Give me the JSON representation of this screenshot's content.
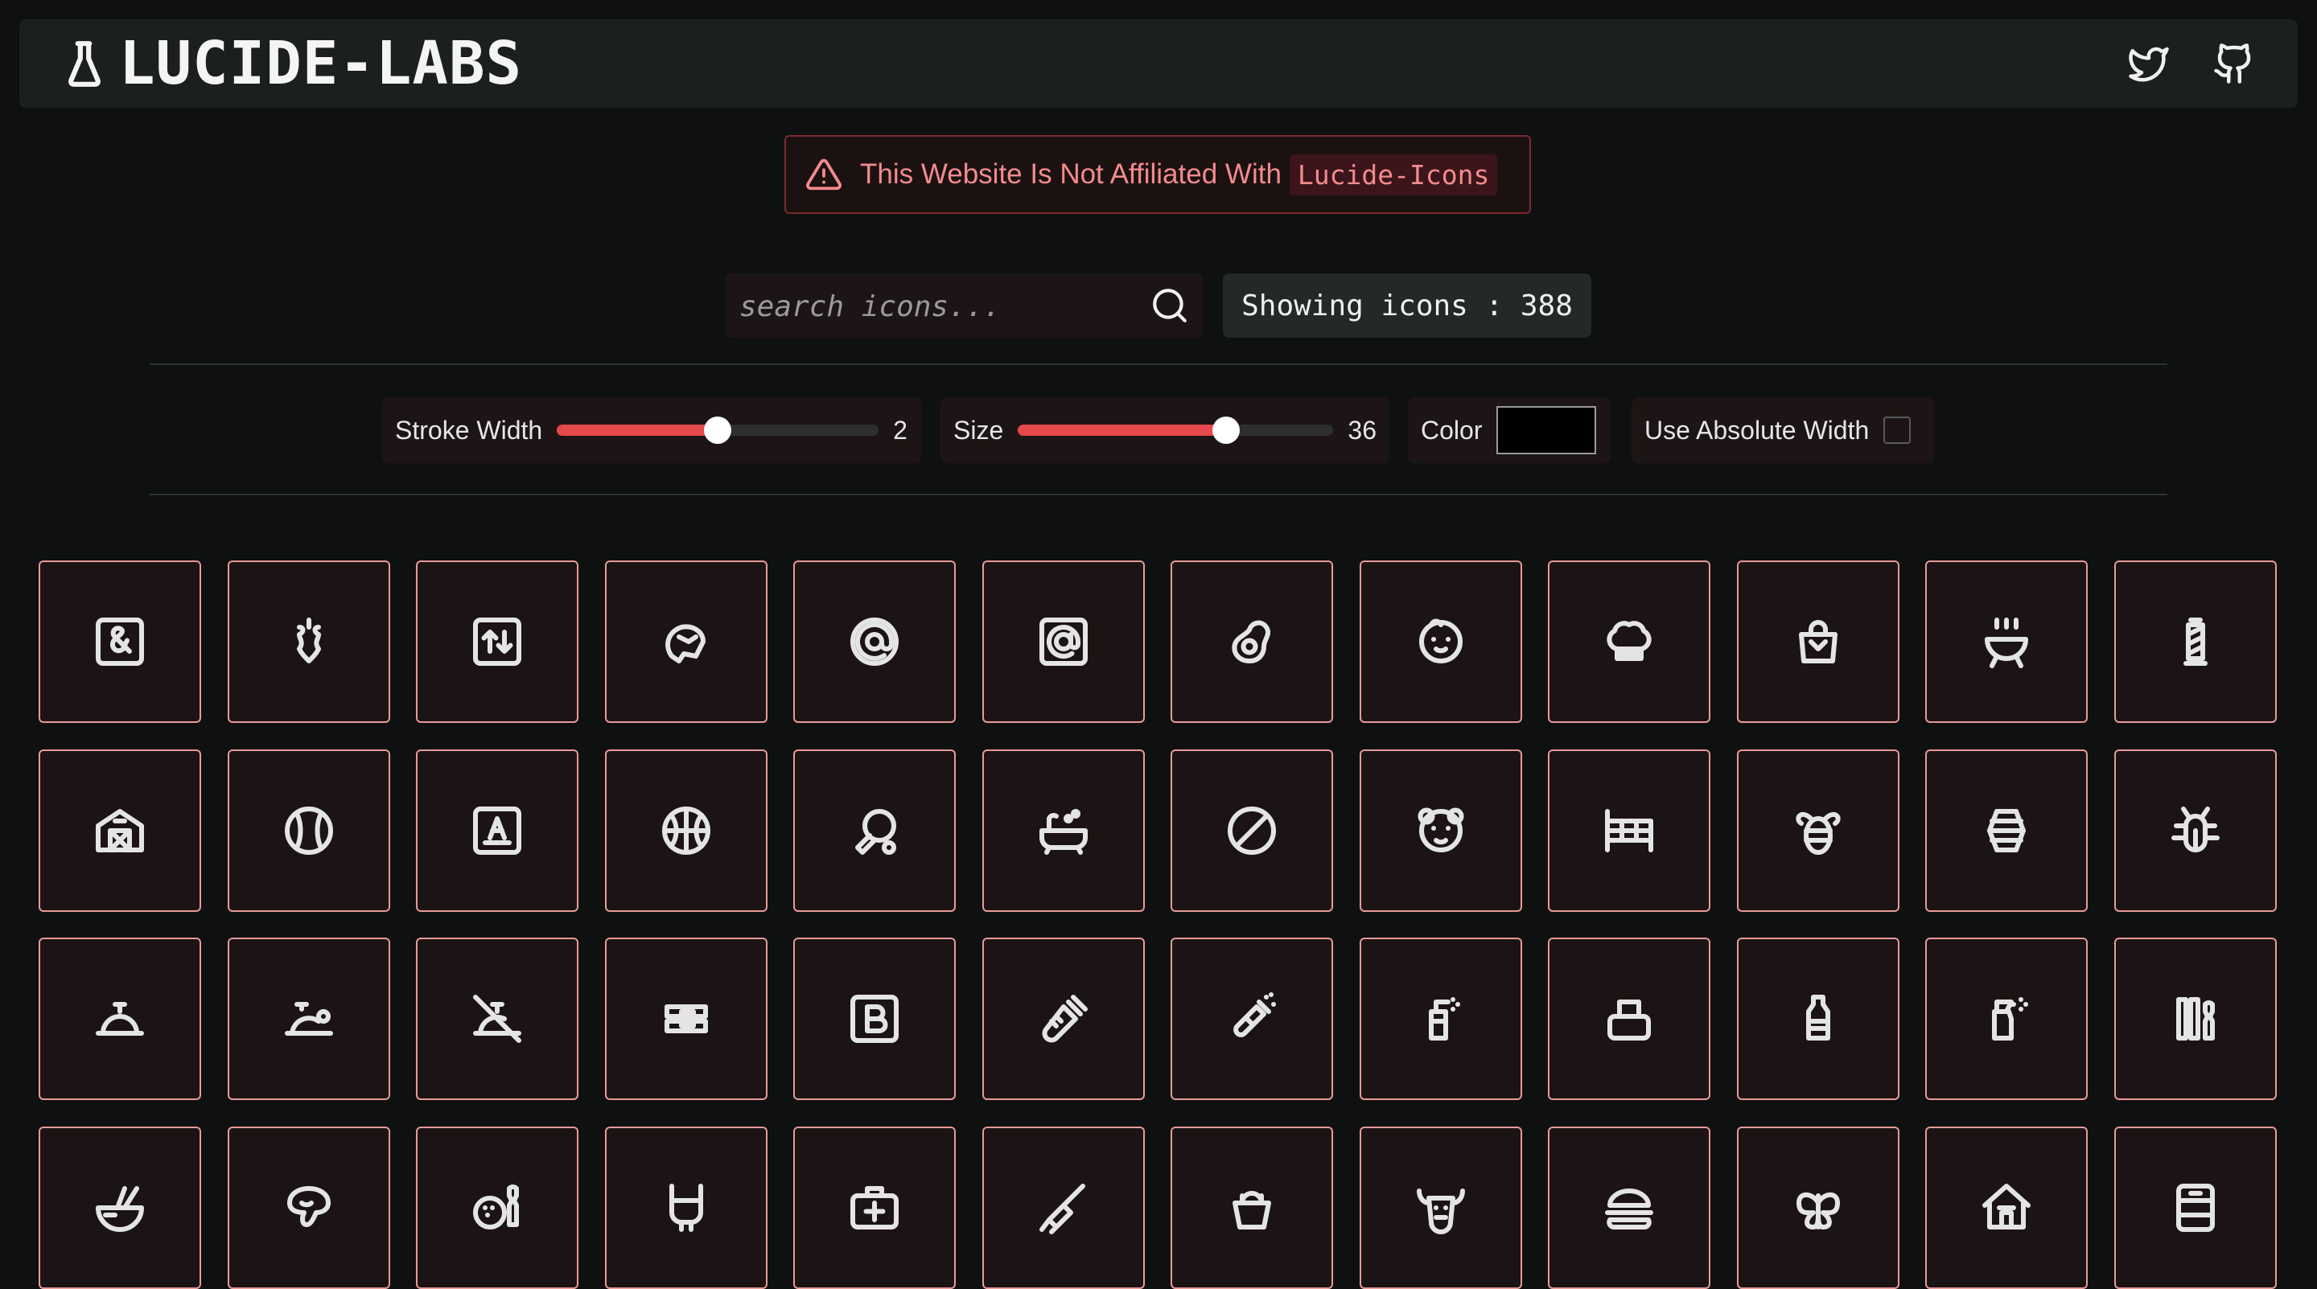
{
  "header": {
    "brand": "LUCIDE-LABS"
  },
  "notice": {
    "text": "This Website Is Not Affiliated With",
    "code": "Lucide-Icons"
  },
  "search": {
    "placeholder": "search icons...",
    "value": ""
  },
  "count": {
    "label": "Showing icons : 388"
  },
  "controls": {
    "stroke": {
      "label": "Stroke Width",
      "value": "2",
      "fraction": 0.5
    },
    "size": {
      "label": "Size",
      "value": "36",
      "fraction": 0.66
    },
    "color": {
      "label": "Color",
      "value": "#000000"
    },
    "absolute": {
      "label": "Use Absolute Width",
      "checked": false
    }
  },
  "colors": {
    "accent": "#e5484d",
    "tile_border": "#e89a98",
    "notice_text": "#f28b8e"
  },
  "icons": [
    "ampersand-square-icon",
    "apple-core-icon",
    "arrow-up-down-square-icon",
    "baseball-glove-icon",
    "at-circle-icon",
    "at-square-icon",
    "avocado-icon",
    "baby-face-icon",
    "chef-hat-icon",
    "handbag-icon",
    "barbecue-grill-icon",
    "barber-pole-icon",
    "barn-icon",
    "baseball-icon",
    "letter-a-square-icon",
    "basketball-icon",
    "ping-pong-paddle-icon",
    "bathtub-icon",
    "ban-circle-icon",
    "bear-face-icon",
    "bed-frame-icon",
    "bee-icon",
    "beehive-icon",
    "bug-icon",
    "service-bell-icon",
    "bellhop-bell-icon",
    "bell-off-icon",
    "belt-icon",
    "bold-square-icon",
    "baby-bottle-icon",
    "champagne-bottle-icon",
    "soap-dispenser-icon",
    "ink-bottle-icon",
    "water-bottle-icon",
    "spray-bottle-icon",
    "bowling-pins-icon",
    "bowl-chopsticks-icon",
    "brain-icon",
    "bowling-icon",
    "laboratory-flask-icon",
    "first-aid-kit-icon",
    "broom-icon",
    "bucket-icon",
    "bull-head-icon",
    "burger-icon",
    "butterfly-icon",
    "house-icon",
    "cabinet-icon"
  ]
}
